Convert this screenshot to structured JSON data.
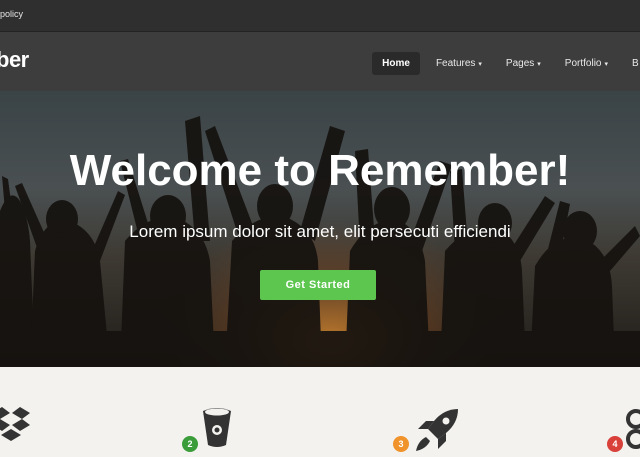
{
  "topbar": {
    "policy_text": "policy"
  },
  "navbar": {
    "logo_text": "ber",
    "items": [
      {
        "label": "Home",
        "active": true
      },
      {
        "label": "Features",
        "dropdown": true
      },
      {
        "label": "Pages",
        "dropdown": true
      },
      {
        "label": "Portfolio",
        "dropdown": true
      },
      {
        "label": "B"
      }
    ]
  },
  "hero": {
    "title": "Welcome to Remember!",
    "subtitle": "Lorem ipsum dolor sit amet, elit persecuti efficiendi",
    "cta_label": "Get Started"
  },
  "features": {
    "badges": [
      {
        "number": "2",
        "color": "#3a9d3a"
      },
      {
        "number": "3",
        "color": "#f0932b"
      },
      {
        "number": "4",
        "color": "#d9403a"
      }
    ],
    "icons": [
      "dropbox-icon",
      "bitbucket-icon",
      "rocket-icon",
      "link-icon"
    ]
  },
  "colors": {
    "accent": "#5cc64f",
    "nav_bg": "#3d3d3d",
    "topbar_bg": "#2f2f2f"
  }
}
